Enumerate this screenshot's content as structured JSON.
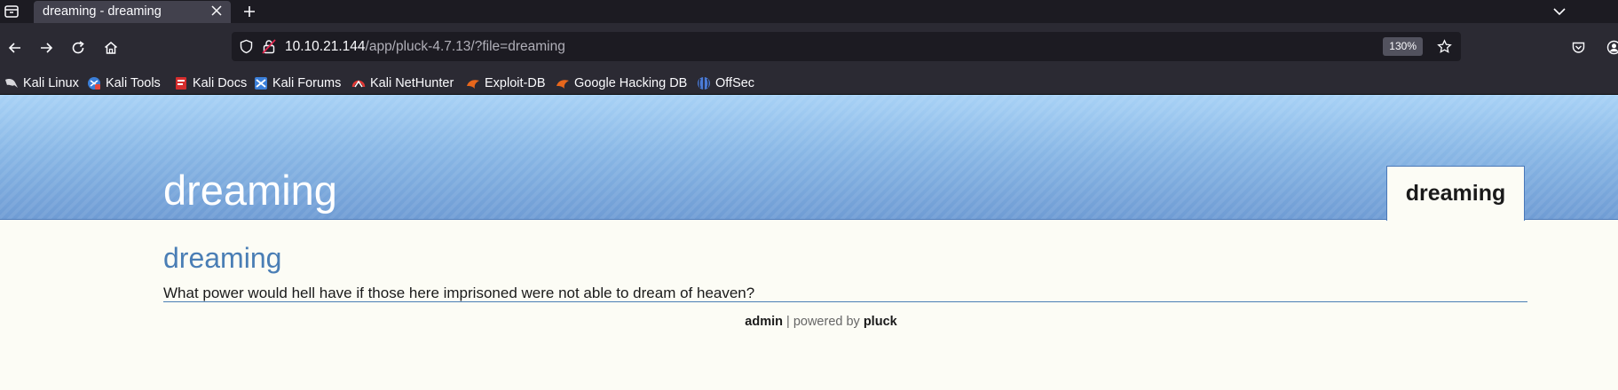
{
  "browser": {
    "tab": {
      "title": "dreaming - dreaming"
    },
    "url": {
      "host": "10.10.21.144",
      "path": "/app/pluck-4.7.13/?file=dreaming"
    },
    "zoom": "130%",
    "bookmarks": [
      {
        "label": "Kali Linux",
        "icon": "kali-dragon-icon"
      },
      {
        "label": "Kali Tools",
        "icon": "kali-tools-icon"
      },
      {
        "label": "Kali Docs",
        "icon": "kali-docs-icon"
      },
      {
        "label": "Kali Forums",
        "icon": "kali-forums-icon"
      },
      {
        "label": "Kali NetHunter",
        "icon": "kali-nethunter-icon"
      },
      {
        "label": "Exploit-DB",
        "icon": "exploit-db-icon"
      },
      {
        "label": "Google Hacking DB",
        "icon": "ghdb-icon"
      },
      {
        "label": "OffSec",
        "icon": "offsec-icon"
      }
    ]
  },
  "site": {
    "title": "dreaming",
    "menu": [
      "dreaming"
    ],
    "page_title": "dreaming",
    "body_text": "What power would hell have if those here imprisoned were not able to dream of heaven?",
    "footer": {
      "admin": "admin",
      "separator": " | powered by ",
      "powered": "pluck"
    }
  },
  "colors": {
    "header_top": "#a8d2f6",
    "header_bottom": "#6f9cd4",
    "heading_blue": "#4a7eb5",
    "page_bg": "#fcfcf5"
  }
}
